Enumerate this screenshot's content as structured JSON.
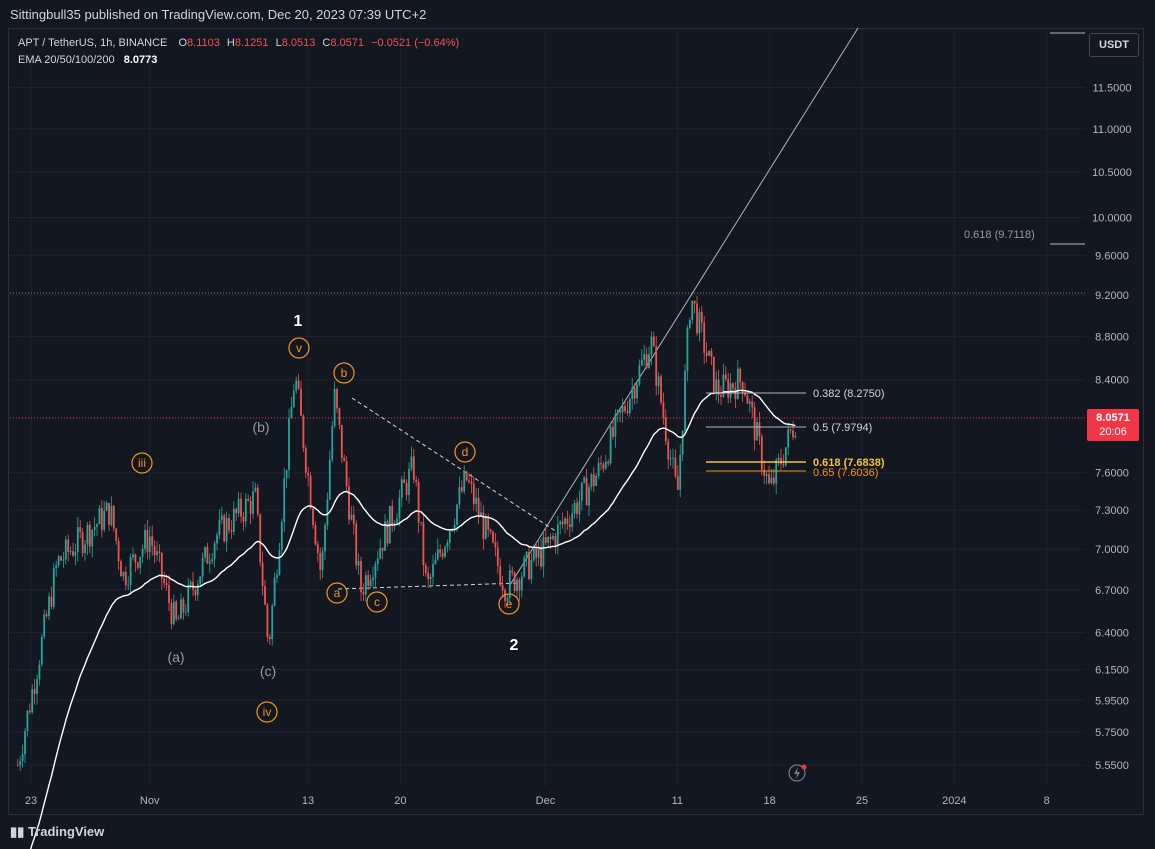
{
  "header": {
    "publish_line": "Sittingbull35 published on TradingView.com, Dec 20, 2023 07:39 UTC+2"
  },
  "legend": {
    "symbol": "APT / TetherUS, 1h, BINANCE",
    "o_label": "O",
    "o_value": "8.1103",
    "h_label": "H",
    "h_value": "8.1251",
    "l_label": "L",
    "l_value": "8.0513",
    "c_label": "C",
    "c_value": "8.0571",
    "change": "−0.0521 (−0.64%)",
    "ema_label": "EMA 20/50/100/200",
    "ema_value": "8.0773"
  },
  "currency_button": "USDT",
  "last_price": {
    "value": "8.0571",
    "countdown": "20:06"
  },
  "footer": {
    "logo_text": "TradingView"
  },
  "colors": {
    "background": "#131722",
    "up": "#26a69a",
    "down": "#ef5350",
    "orange": "#f7931a",
    "text": "#d1d4dc",
    "ema": "#ffffff",
    "fib_gold": "#f5c242"
  },
  "chart_data": {
    "type": "candlestick",
    "y_axis": {
      "ticks": [
        "11.5000",
        "11.0000",
        "10.5000",
        "10.0000",
        "9.6000",
        "9.2000",
        "8.8000",
        "8.4000",
        "7.6000",
        "7.3000",
        "7.0000",
        "6.7000",
        "6.4000",
        "6.1500",
        "5.9500",
        "5.7500",
        "5.5500"
      ],
      "scale": "log"
    },
    "x_axis": {
      "ticks": [
        "23",
        "Nov",
        "13",
        "20",
        "Dec",
        "11",
        "18",
        "25",
        "2024",
        "8"
      ]
    },
    "fib_levels": [
      {
        "label": "0.382 (8.2750)",
        "value": 8.275
      },
      {
        "label": "0.5 (7.9794)",
        "value": 7.9794
      },
      {
        "label": "0.618 (7.6838)",
        "value": 7.6838
      },
      {
        "label": "0.65 (7.6036)",
        "value": 7.6036
      },
      {
        "label": "0.618 (9.7118)",
        "value": 9.7118
      }
    ],
    "horizontal_levels": [
      9.23,
      8.0571
    ],
    "wave_labels": [
      {
        "text": "1",
        "style": "major"
      },
      {
        "text": "2",
        "style": "major"
      },
      {
        "text": "iii",
        "style": "circle"
      },
      {
        "text": "iv",
        "style": "circle"
      },
      {
        "text": "v",
        "style": "circle"
      },
      {
        "text": "a",
        "style": "circle"
      },
      {
        "text": "b",
        "style": "circle"
      },
      {
        "text": "c",
        "style": "circle"
      },
      {
        "text": "d",
        "style": "circle"
      },
      {
        "text": "e",
        "style": "circle"
      },
      {
        "text": "(a)",
        "style": "paren"
      },
      {
        "text": "(b)",
        "style": "paren"
      },
      {
        "text": "(c)",
        "style": "paren"
      }
    ],
    "price_path": [
      {
        "date": "Oct 22",
        "price": 5.55
      },
      {
        "date": "Oct 25",
        "price": 6.9
      },
      {
        "date": "Oct 29",
        "price": 7.3
      },
      {
        "date": "Oct 30",
        "price": 6.8
      },
      {
        "date": "Nov 1",
        "price": 7.1
      },
      {
        "date": "Nov 3",
        "price": 6.45
      },
      {
        "date": "Nov 6",
        "price": 7.1
      },
      {
        "date": "Nov 9",
        "price": 7.4
      },
      {
        "date": "Nov 10",
        "price": 6.3
      },
      {
        "date": "Nov 12",
        "price": 8.45
      },
      {
        "date": "Nov 14",
        "price": 6.8
      },
      {
        "date": "Nov 15",
        "price": 8.25
      },
      {
        "date": "Nov 17",
        "price": 6.7
      },
      {
        "date": "Nov 21",
        "price": 7.65
      },
      {
        "date": "Nov 22",
        "price": 6.7
      },
      {
        "date": "Nov 25",
        "price": 7.55
      },
      {
        "date": "Nov 28",
        "price": 6.72
      },
      {
        "date": "Dec 1",
        "price": 7.0
      },
      {
        "date": "Dec 5",
        "price": 7.6
      },
      {
        "date": "Dec 9",
        "price": 8.75
      },
      {
        "date": "Dec 11",
        "price": 7.4
      },
      {
        "date": "Dec 12",
        "price": 9.2
      },
      {
        "date": "Dec 14",
        "price": 8.3
      },
      {
        "date": "Dec 16",
        "price": 8.4
      },
      {
        "date": "Dec 18",
        "price": 7.45
      },
      {
        "date": "Dec 20",
        "price": 8.0571
      }
    ]
  }
}
